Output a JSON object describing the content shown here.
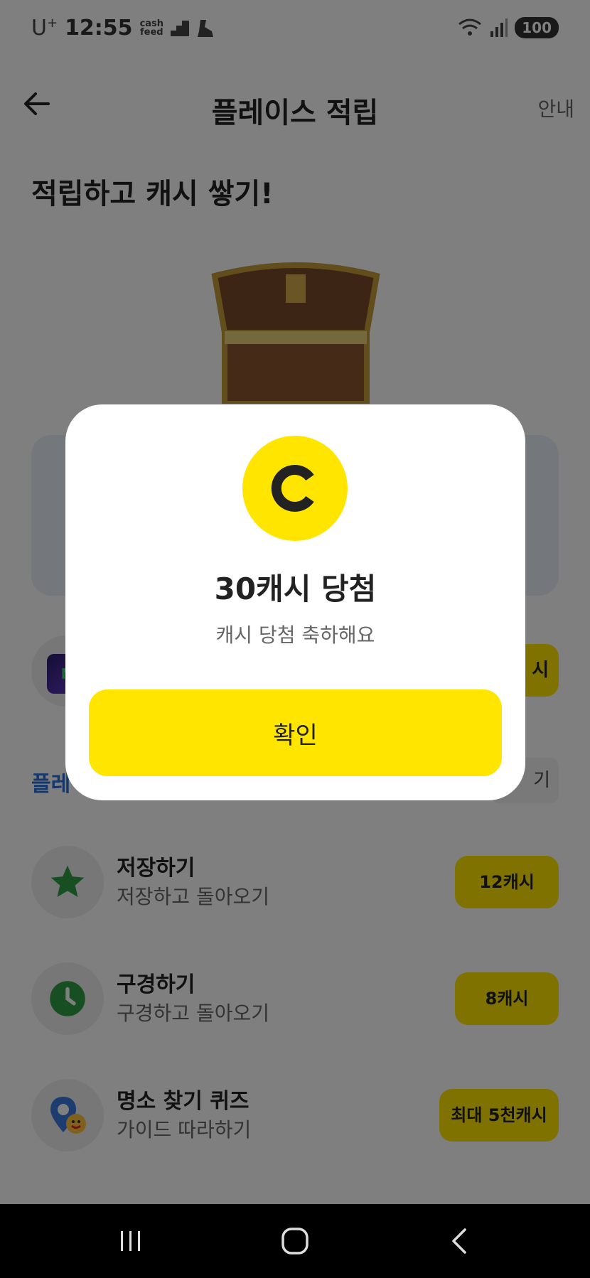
{
  "status_bar": {
    "carrier": "U",
    "carrier_sup": "+",
    "time": "12:55",
    "app_badge_line1": "cash",
    "app_badge_line2": "feed",
    "battery": "100"
  },
  "header": {
    "title": "플레이스 적립",
    "guide_label": "안내"
  },
  "headline": "적립하고 캐시 쌓기!",
  "ad_row": {
    "logo_letter": "N",
    "pill_partial": "시"
  },
  "section": {
    "title_partial": "플레",
    "button_partial": "기"
  },
  "tasks": [
    {
      "title": "저장하기",
      "subtitle": "저장하고 돌아오기",
      "reward": "12캐시",
      "icon": "star-icon"
    },
    {
      "title": "구경하기",
      "subtitle": "구경하고 돌아오기",
      "reward": "8캐시",
      "icon": "clock-icon"
    },
    {
      "title": "명소 찾기 퀴즈",
      "subtitle": "가이드 따라하기",
      "reward": "최대 5천캐시",
      "icon": "map-pin-smile-icon"
    }
  ],
  "modal": {
    "title": "30캐시 당첨",
    "subtitle": "캐시 당첨 축하해요",
    "confirm_label": "확인"
  },
  "colors": {
    "accent_yellow": "#ffe500",
    "section_blue": "#2b6fd8",
    "star_green": "#2e9e44"
  }
}
